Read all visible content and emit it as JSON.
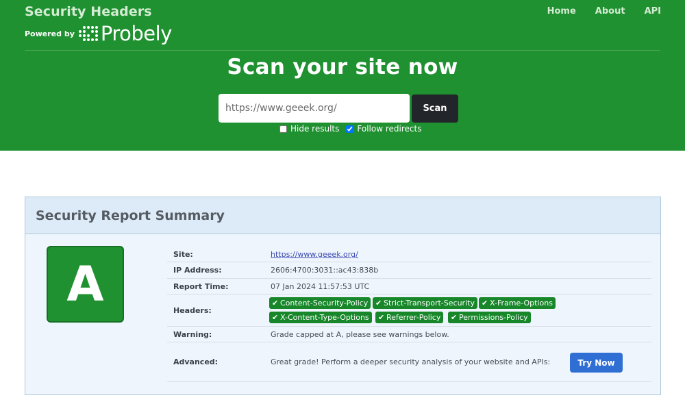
{
  "brand": {
    "title": "Security Headers",
    "powered_by": "Powered by",
    "partner": "Probely"
  },
  "nav": {
    "items": [
      "Home",
      "About",
      "API"
    ]
  },
  "scan": {
    "heading": "Scan your site now",
    "input_value": "https://www.geeek.org/",
    "button_label": "Scan",
    "hide_results_label": "Hide results",
    "hide_results_checked": false,
    "follow_redirects_label": "Follow redirects",
    "follow_redirects_checked": true
  },
  "report": {
    "title": "Security Report Summary",
    "grade": "A",
    "rows": {
      "site_label": "Site:",
      "site_value": "https://www.geeek.org/",
      "ip_label": "IP Address:",
      "ip_value": "2606:4700:3031::ac43:838b",
      "time_label": "Report Time:",
      "time_value": "07 Jan 2024 11:57:53 UTC",
      "headers_label": "Headers:",
      "headers": [
        "Content-Security-Policy",
        "Strict-Transport-Security",
        "X-Frame-Options",
        "X-Content-Type-Options",
        "Referrer-Policy",
        "Permissions-Policy"
      ],
      "warning_label": "Warning:",
      "warning_value": "Grade capped at A, please see warnings below.",
      "advanced_label": "Advanced:",
      "advanced_value": "Great grade! Perform a deeper security analysis of your website and APIs:",
      "try_label": "Try Now"
    }
  },
  "colors": {
    "hero_green": "#1f9130",
    "badge_green": "#17872a",
    "scan_button": "#222529",
    "try_button": "#2f6fd3",
    "report_header": "#ddebf8"
  }
}
